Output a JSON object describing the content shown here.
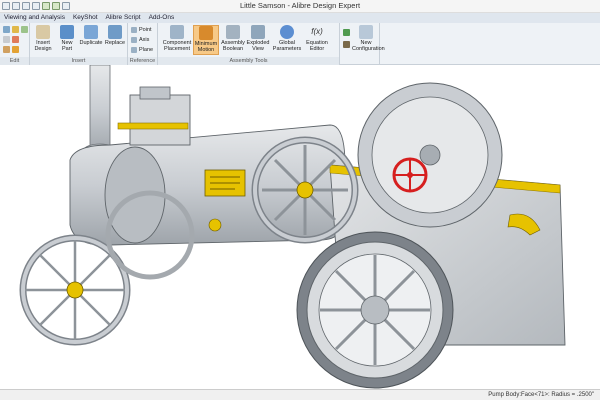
{
  "window": {
    "title": "Little Samson - Alibre Design Expert"
  },
  "menu": {
    "tabs": [
      "Viewing and Analysis",
      "KeyShot",
      "Alibre Script",
      "Add-Ons"
    ]
  },
  "ribbon": {
    "groups": {
      "edit": "Edit",
      "insert": "Insert",
      "reference": "Reference",
      "assembly_tools": "Assembly Tools"
    },
    "buttons": {
      "insert_design": "Insert Design",
      "new_part": "New Part",
      "duplicate": "Duplicate",
      "replace": "Replace",
      "point": "Point",
      "axis": "Axis",
      "plane": "Plane",
      "component_placement": "Component Placement",
      "minimum_motion": "Minimum Motion",
      "assembly_boolean": "Assembly Boolean",
      "exploded_view": "Exploded View",
      "global_parameters": "Global Parameters",
      "equation_editor": "Equation Editor",
      "new_configuration": "New Configuration"
    },
    "icons": {
      "equation": "f(x)"
    }
  },
  "status": {
    "text": "Pump Body:Face<71>: Radius = .2500\""
  },
  "colors": {
    "accent": "#f7c987",
    "ribbon_bg": "#eef2f6",
    "model_grey": "#c9cdd2",
    "brass": "#e6c200",
    "red_wheel": "#d61f1f"
  }
}
